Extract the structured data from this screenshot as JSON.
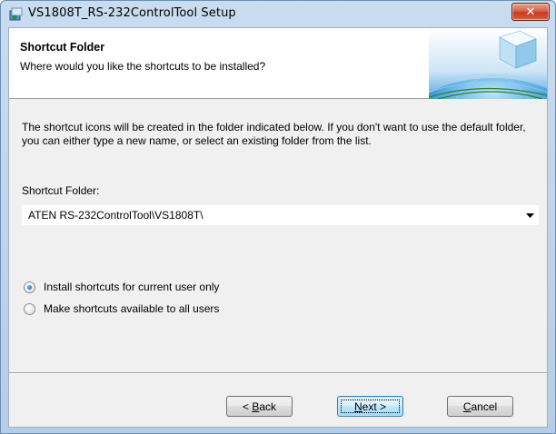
{
  "window": {
    "title": "VS1808T_RS-232ControlTool Setup",
    "close_label": "✕"
  },
  "header": {
    "title": "Shortcut Folder",
    "subtitle": "Where would you like the shortcuts to be installed?"
  },
  "description": "The shortcut icons will be created in the folder indicated below. If you don't want to use the default folder, you can either type a new name, or select an existing folder from the list.",
  "folder": {
    "label": "Shortcut Folder:",
    "value": "ATEN RS-232ControlTool\\VS1808T\\"
  },
  "options": [
    {
      "label": "Install shortcuts for current user only",
      "checked": true
    },
    {
      "label": "Make shortcuts available to all users",
      "checked": false
    }
  ],
  "buttons": {
    "back_prefix": "< ",
    "back_mnemonic": "B",
    "back_rest": "ack",
    "next_mnemonic": "N",
    "next_rest": "ext >",
    "cancel_mnemonic": "C",
    "cancel_rest": "ancel"
  },
  "colors": {
    "title_bar": "#c9dcf0",
    "close_button": "#c6391f",
    "dialog_background": "#f0f0f0",
    "default_button": "#bee6fd"
  },
  "icons": {
    "app": "installer-icon",
    "combo": "dropdown-arrow-icon",
    "header": "globe-cube-graphic"
  }
}
